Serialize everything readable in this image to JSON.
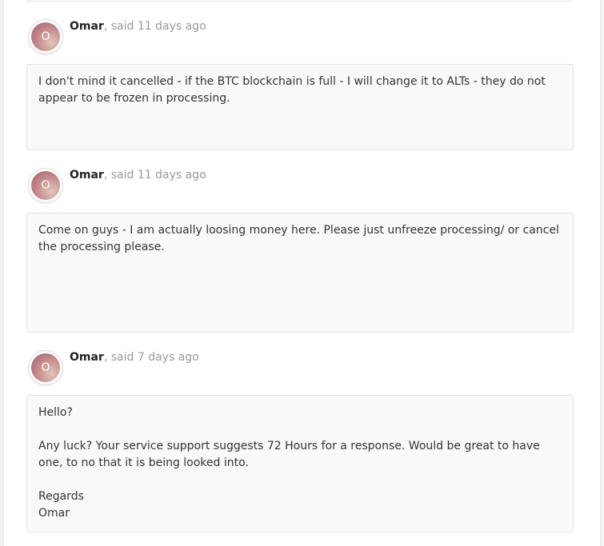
{
  "comments": [
    {
      "author": "Omar",
      "said": ", said 11 days ago",
      "avatar_letter": "O",
      "paragraphs": [
        "I don't mind it cancelled - if the BTC blockchain is full - I will change it to ALTs - they do not appear to be frozen in processing."
      ]
    },
    {
      "author": "Omar",
      "said": ", said 11 days ago",
      "avatar_letter": "O",
      "paragraphs": [
        "Come on guys - I am actually loosing money here. Please just unfreeze processing/ or cancel the processing please."
      ]
    },
    {
      "author": "Omar",
      "said": ", said 7 days ago",
      "avatar_letter": "O",
      "paragraphs": [
        "Hello?",
        "Any luck? Your service support suggests 72 Hours for a response. Would be great to have one, to no that it is being looked into.",
        "Regards",
        "Omar"
      ]
    }
  ]
}
